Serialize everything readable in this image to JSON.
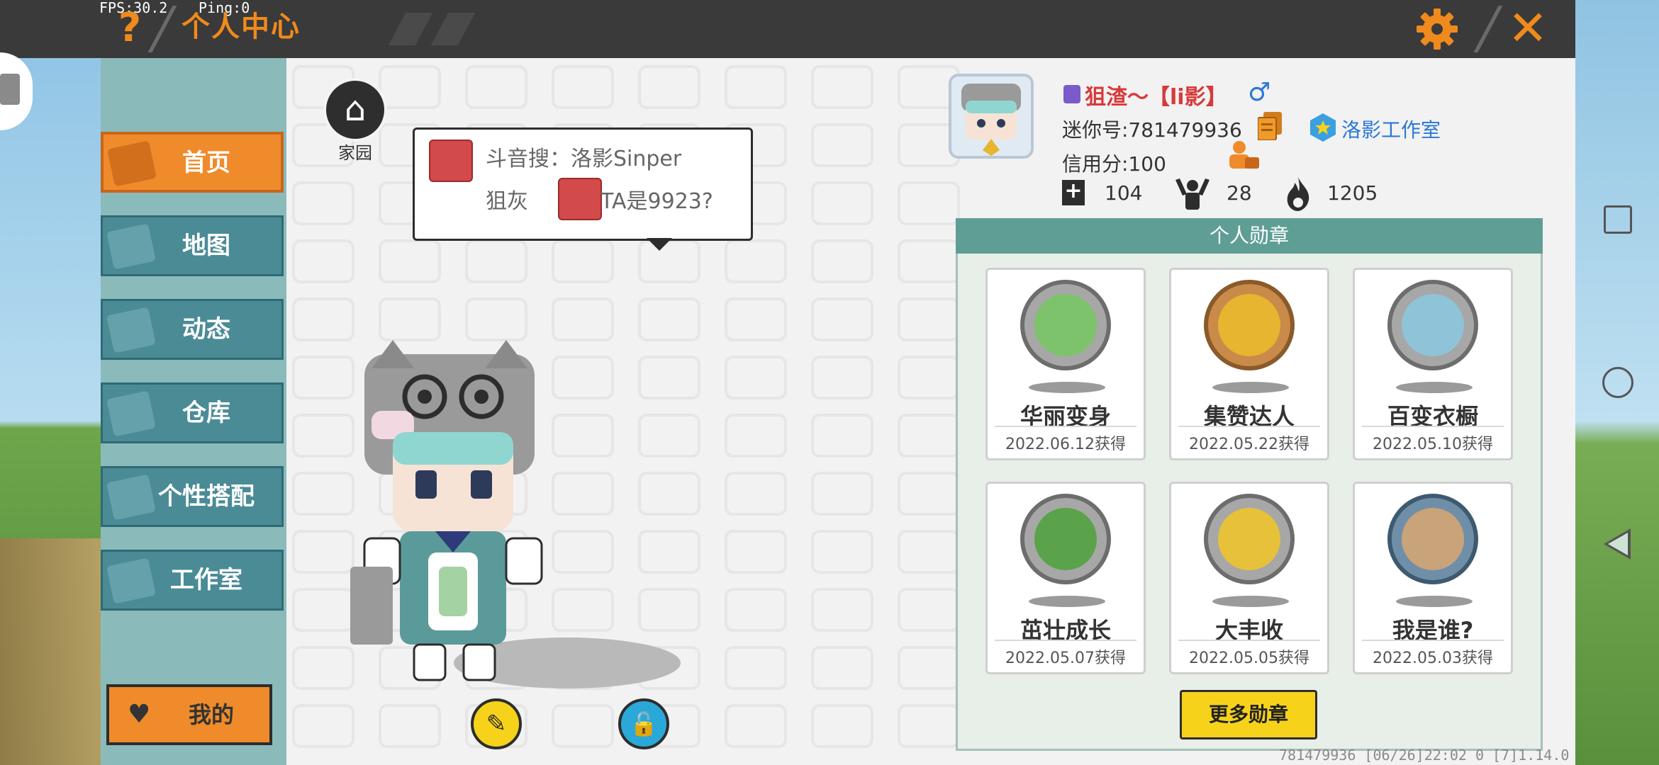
{
  "debug": {
    "fps": "FPS:30.2",
    "ping": "Ping:0"
  },
  "header": {
    "title": "个人中心",
    "help": "?",
    "close": "✕"
  },
  "sidebar": {
    "items": [
      {
        "label": "首页",
        "active": true
      },
      {
        "label": "地图"
      },
      {
        "label": "动态"
      },
      {
        "label": "仓库"
      },
      {
        "label": "个性搭配"
      },
      {
        "label": "工作室"
      }
    ],
    "mine_label": "我的"
  },
  "home": {
    "label": "家园"
  },
  "bubble": {
    "line1": "斗音搜：洛影Sinper",
    "line2_left": "狙灰",
    "line2_right": "TA是9923?"
  },
  "profile": {
    "username": "狙渣～【li影】",
    "gender_icon": "male-icon",
    "mini_id": "迷你号:781479936",
    "studio": "洛影工作室",
    "credit": "信用分:100",
    "stats": {
      "plus": "104",
      "fans": "28",
      "hot": "1205"
    }
  },
  "badges": {
    "header": "个人勋章",
    "items": [
      {
        "name": "华丽变身",
        "date": "2022.06.12获得",
        "color": "#7cc36b"
      },
      {
        "name": "集赞达人",
        "date": "2022.05.22获得",
        "color": "#e7b52f"
      },
      {
        "name": "百变衣橱",
        "date": "2022.05.10获得",
        "color": "#8fc3d8"
      },
      {
        "name": "茁壮成长",
        "date": "2022.05.07获得",
        "color": "#5aa34a"
      },
      {
        "name": "大丰收",
        "date": "2022.05.05获得",
        "color": "#e8c13a"
      },
      {
        "name": "我是谁?",
        "date": "2022.05.03获得",
        "color": "#c9a37a"
      }
    ],
    "more_label": "更多勋章"
  },
  "footer": {
    "info": "781479936   [06/26]22:02 0   [7]1.14.0"
  },
  "colors": {
    "accent": "#ef8b2b",
    "teal": "#4a8b96",
    "badge_header": "#5f9e95",
    "yellow": "#f7d21b"
  }
}
